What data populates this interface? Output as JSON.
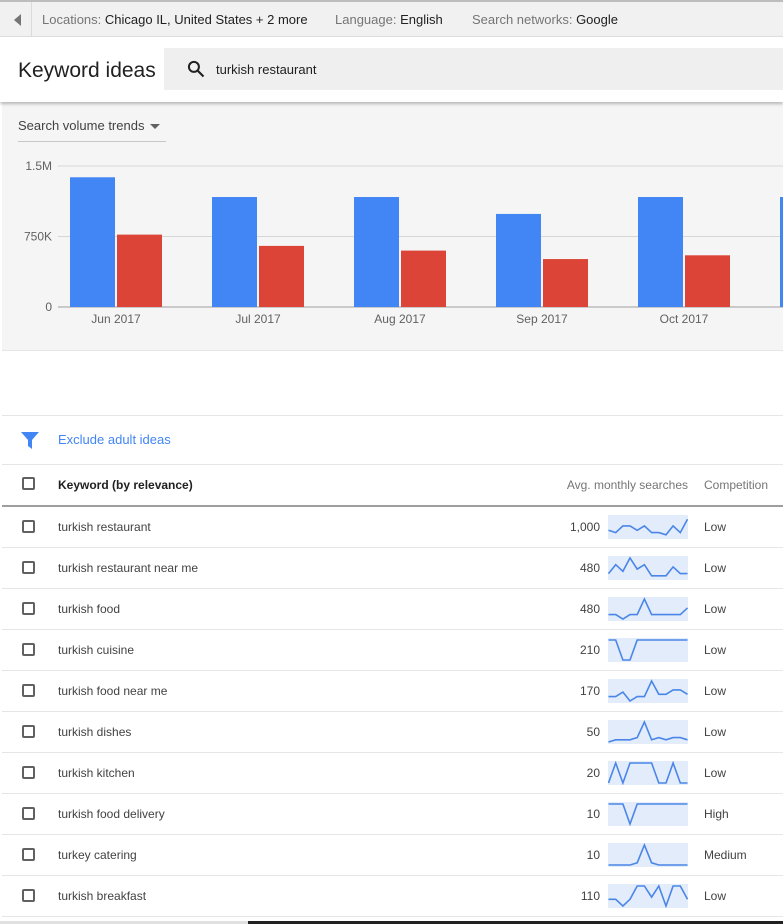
{
  "filters": {
    "locations_label": "Locations:",
    "locations_value": "Chicago IL, United States + 2 more",
    "language_label": "Language:",
    "language_value": "English",
    "networks_label": "Search networks:",
    "networks_value": "Google"
  },
  "header": {
    "title": "Keyword ideas",
    "search_value": "turkish restaurant"
  },
  "chart_panel": {
    "dropdown_label": "Search volume trends"
  },
  "colors": {
    "blue": "#4285f4",
    "red": "#db4437",
    "link": "#4285f4"
  },
  "chart_data": {
    "type": "bar",
    "categories": [
      "Jun 2017",
      "Jul 2017",
      "Aug 2017",
      "Sep 2017",
      "Oct 2017"
    ],
    "series": [
      {
        "values": [
          1380000,
          1170000,
          1170000,
          990000,
          1170000
        ]
      },
      {
        "values": [
          770000,
          650000,
          600000,
          510000,
          550000
        ]
      }
    ],
    "ylim": [
      0,
      1500000
    ],
    "yticks": [
      "0",
      "750K",
      "1.5M"
    ],
    "grid": true
  },
  "exclude_label": "Exclude adult ideas",
  "table": {
    "col_keyword": "Keyword (by relevance)",
    "col_avg": "Avg. monthly searches",
    "col_competition": "Competition",
    "rows": [
      {
        "keyword": "turkish restaurant",
        "avg": "1,000",
        "competition": "Low",
        "trend": [
          3,
          2,
          5,
          5,
          3,
          5,
          2,
          2,
          1,
          5,
          2,
          8
        ]
      },
      {
        "keyword": "turkish restaurant near me",
        "avg": "480",
        "competition": "Low",
        "trend": [
          2,
          6,
          3,
          9,
          4,
          6,
          1,
          1,
          1,
          5,
          2,
          2
        ]
      },
      {
        "keyword": "turkish food",
        "avg": "480",
        "competition": "Low",
        "trend": [
          2,
          2,
          0,
          2,
          2,
          9,
          2,
          2,
          2,
          2,
          2,
          5
        ]
      },
      {
        "keyword": "turkish cuisine",
        "avg": "210",
        "competition": "Low",
        "trend": [
          9,
          9,
          0,
          0,
          9,
          9,
          9,
          9,
          9,
          9,
          9,
          9
        ]
      },
      {
        "keyword": "turkish food near me",
        "avg": "170",
        "competition": "Low",
        "trend": [
          2,
          2,
          4,
          0,
          2,
          2,
          9,
          3,
          3,
          5,
          5,
          3
        ]
      },
      {
        "keyword": "turkish dishes",
        "avg": "50",
        "competition": "Low",
        "trend": [
          0,
          1,
          1,
          1,
          2,
          9,
          1,
          2,
          1,
          2,
          2,
          1
        ]
      },
      {
        "keyword": "turkish kitchen",
        "avg": "20",
        "competition": "Low",
        "trend": [
          0,
          9,
          0,
          9,
          9,
          9,
          9,
          0,
          0,
          9,
          0,
          0
        ]
      },
      {
        "keyword": "turkish food delivery",
        "avg": "10",
        "competition": "High",
        "trend": [
          9,
          9,
          9,
          0,
          9,
          9,
          9,
          9,
          9,
          9,
          9,
          9
        ]
      },
      {
        "keyword": "turkey catering",
        "avg": "10",
        "competition": "Medium",
        "trend": [
          0,
          0,
          0,
          0,
          1,
          9,
          1,
          0,
          0,
          0,
          0,
          0
        ]
      },
      {
        "keyword": "turkish breakfast",
        "avg": "110",
        "competition": "Low",
        "trend": [
          3,
          3,
          0,
          3,
          9,
          9,
          4,
          9,
          0,
          9,
          9,
          3
        ]
      }
    ]
  }
}
